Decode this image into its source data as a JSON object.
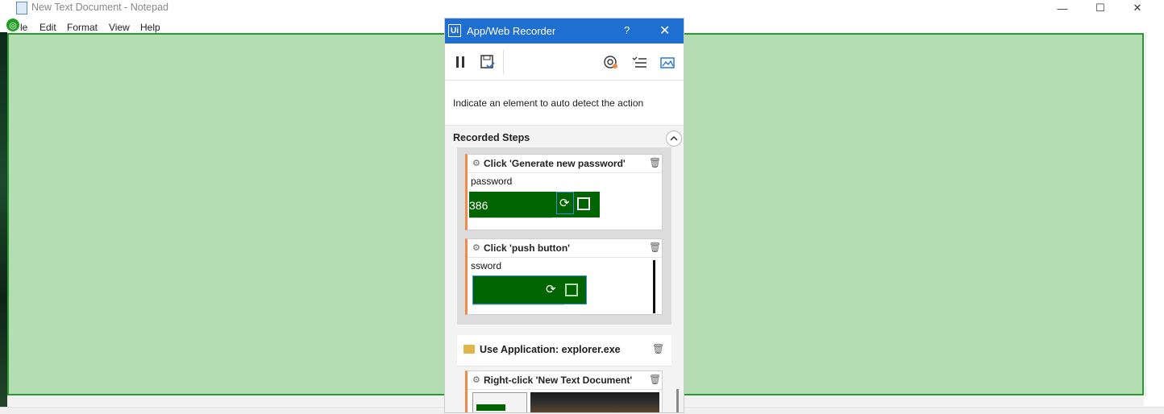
{
  "notepad": {
    "title": "New Text Document - Notepad",
    "menu": [
      "le",
      "Edit",
      "Format",
      "View",
      "Help"
    ],
    "win_controls": {
      "minimize": "—",
      "maximize": "☐",
      "close": "✕"
    }
  },
  "recorder": {
    "title": "App/Web Recorder",
    "logo": "Ui",
    "help": "?",
    "close": "✕",
    "toolbar": {
      "pause_icon": "pause-icon",
      "save_icon": "save-icon",
      "target_icon": "target-icon",
      "checklist_icon": "checklist-icon",
      "screenshot_icon": "screenshot-icon"
    },
    "hint": "Indicate an element to auto detect the action",
    "steps_header": "Recorded Steps",
    "collapse": "^",
    "steps": [
      {
        "title": "Click 'Generate new password'",
        "thumb_label": "password",
        "thumb_value": "386"
      },
      {
        "title": "Click 'push button'",
        "thumb_label": "ssword"
      }
    ],
    "use_application": "Use Application: explorer.exe",
    "last_step": {
      "title": "Right-click 'New Text Document'"
    }
  },
  "colors": {
    "highlight_fill": "#b4ddb4",
    "highlight_border": "#2a9a2a",
    "recorder_title_bg": "#1e6fd1",
    "step_accent": "#f08a4b",
    "thumb_green": "#006400"
  }
}
